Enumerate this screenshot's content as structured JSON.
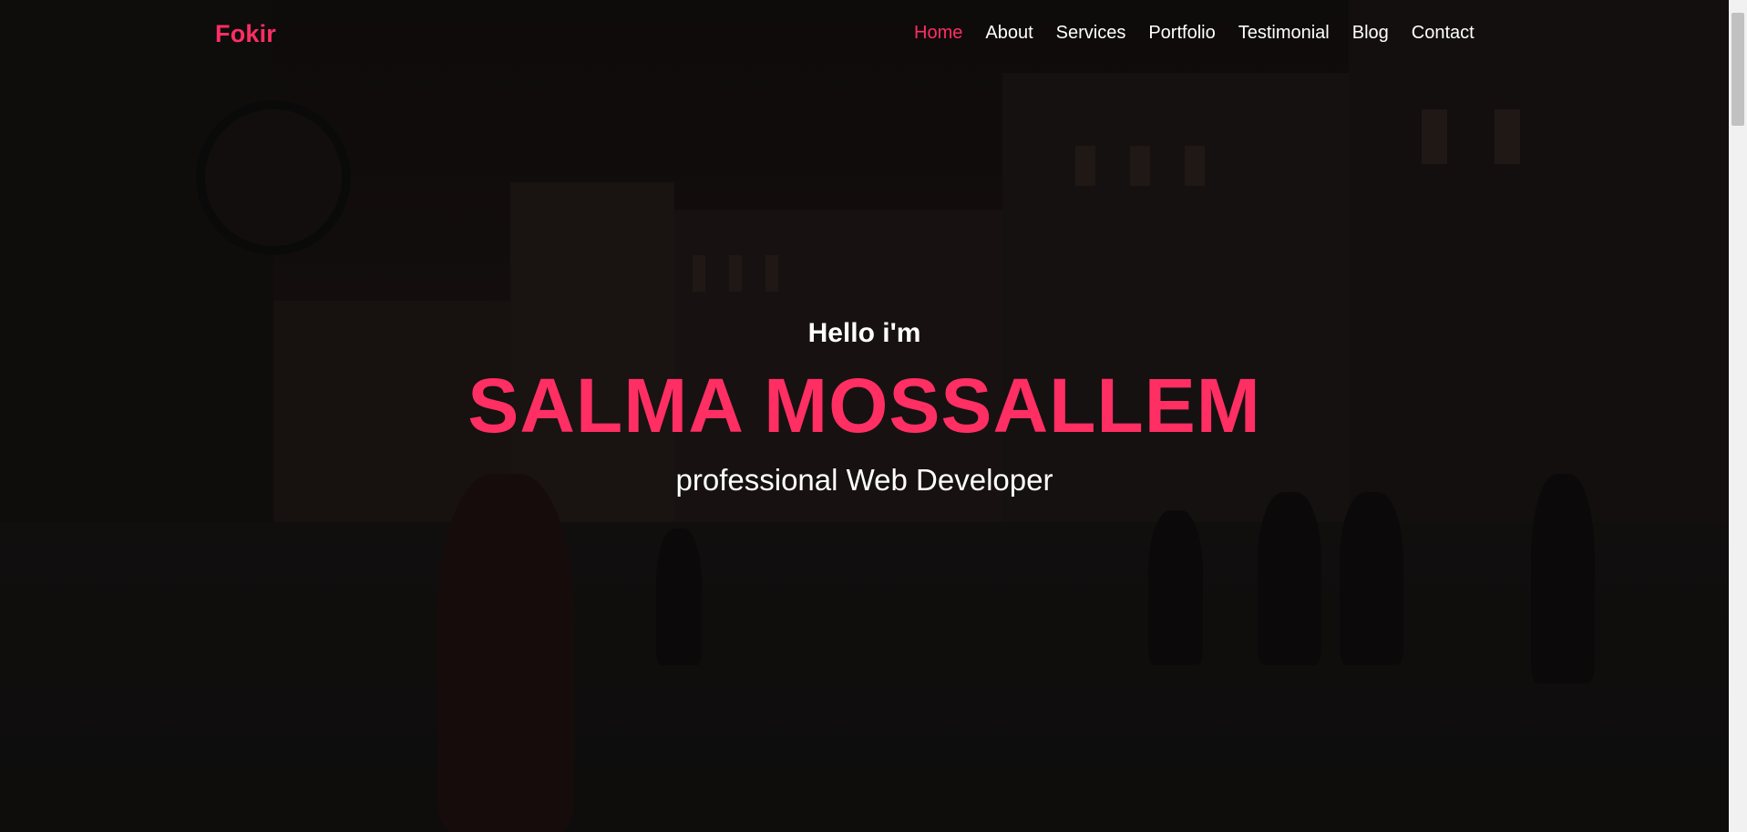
{
  "brand": {
    "name": "Fokir",
    "color": "#ff2e63"
  },
  "nav": {
    "items": [
      {
        "label": "Home",
        "active": true
      },
      {
        "label": "About",
        "active": false
      },
      {
        "label": "Services",
        "active": false
      },
      {
        "label": "Portfolio",
        "active": false
      },
      {
        "label": "Testimonial",
        "active": false
      },
      {
        "label": "Blog",
        "active": false
      },
      {
        "label": "Contact",
        "active": false
      }
    ]
  },
  "hero": {
    "greeting": "Hello i'm",
    "name": "SALMA MOSSALLEM",
    "role": "professional Web Developer",
    "accent_color": "#ff2e63",
    "background": "dark city street photo"
  }
}
